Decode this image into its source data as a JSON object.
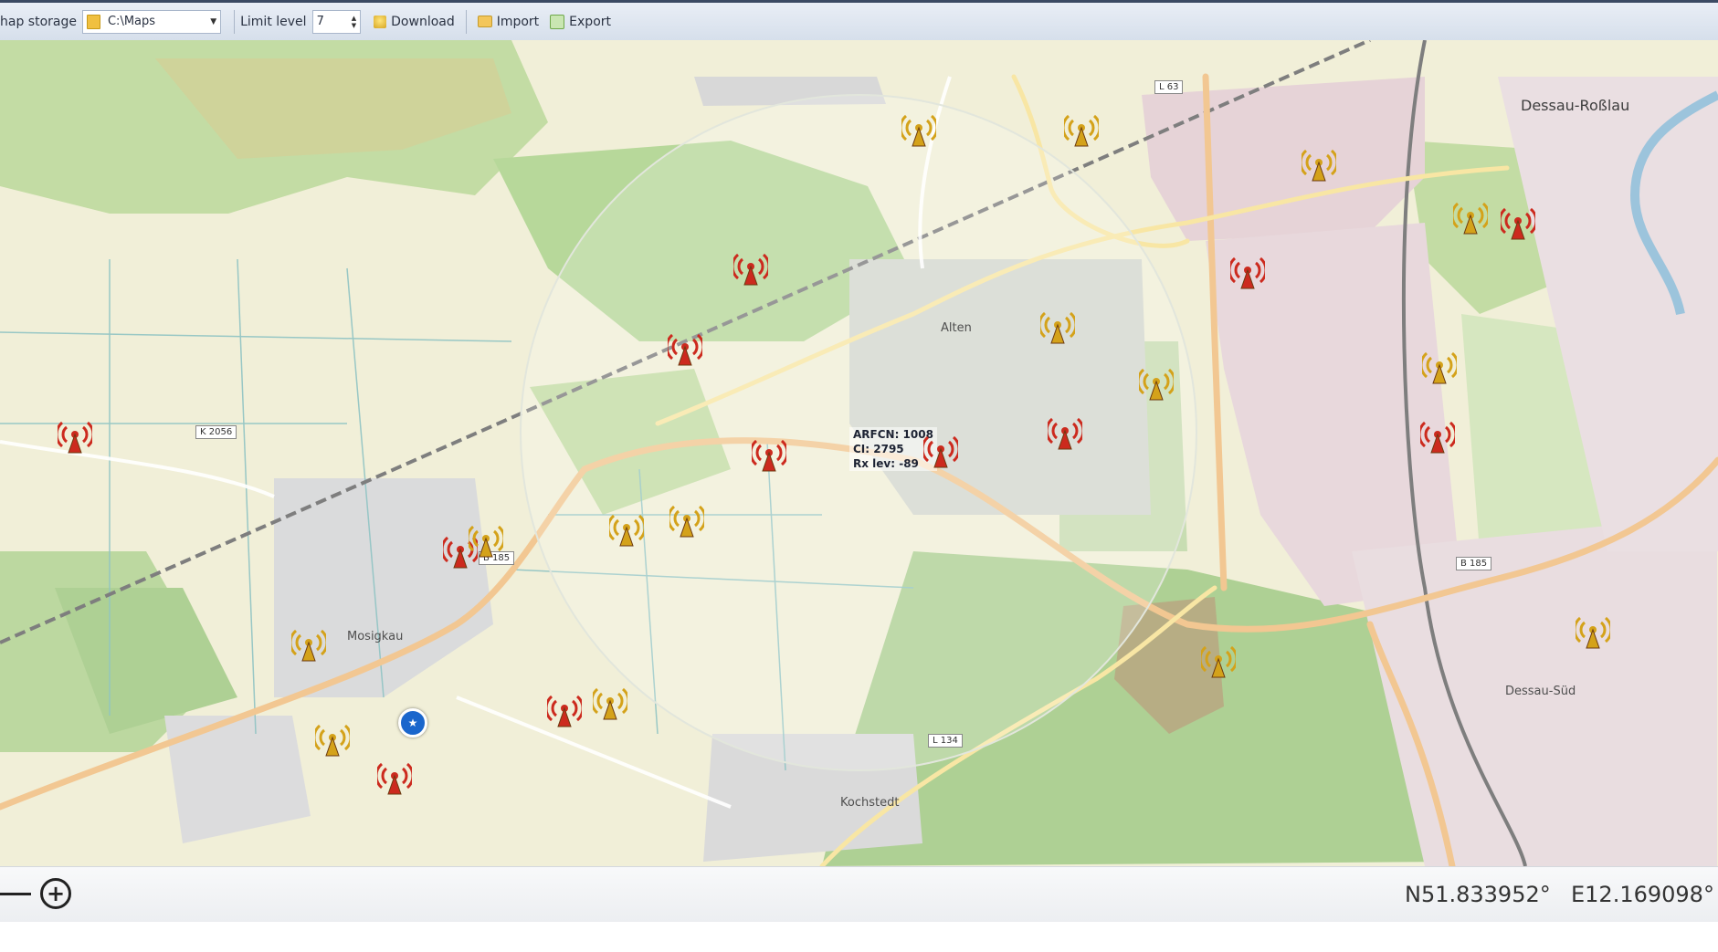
{
  "toolbar": {
    "map_storage_label": "hap storage",
    "map_storage_value": "C:\\Maps",
    "limit_level_label": "Limit level",
    "limit_level_value": "7",
    "download_label": "Download",
    "import_label": "Import",
    "export_label": "Export"
  },
  "map": {
    "places": [
      "Dessau-Roßlau",
      "Mosigkau",
      "Kochstedt",
      "Dessau-Süd",
      "Alten"
    ],
    "roads": [
      "K 2056",
      "B 185",
      "B 185",
      "L 134",
      "L 63"
    ],
    "cell_info": {
      "arfcn": "ARFCN: 1008",
      "ci": "CI: 2795",
      "rx": "Rx lev: -89"
    },
    "colors": {
      "serving_tower": "#cc2a1e",
      "neighbor_tower": "#d4a21a",
      "position_marker": "#1a66cc"
    }
  },
  "status": {
    "zoom_in_symbol": "+",
    "latitude": "N51.833952°",
    "longitude": "E12.169098°"
  }
}
